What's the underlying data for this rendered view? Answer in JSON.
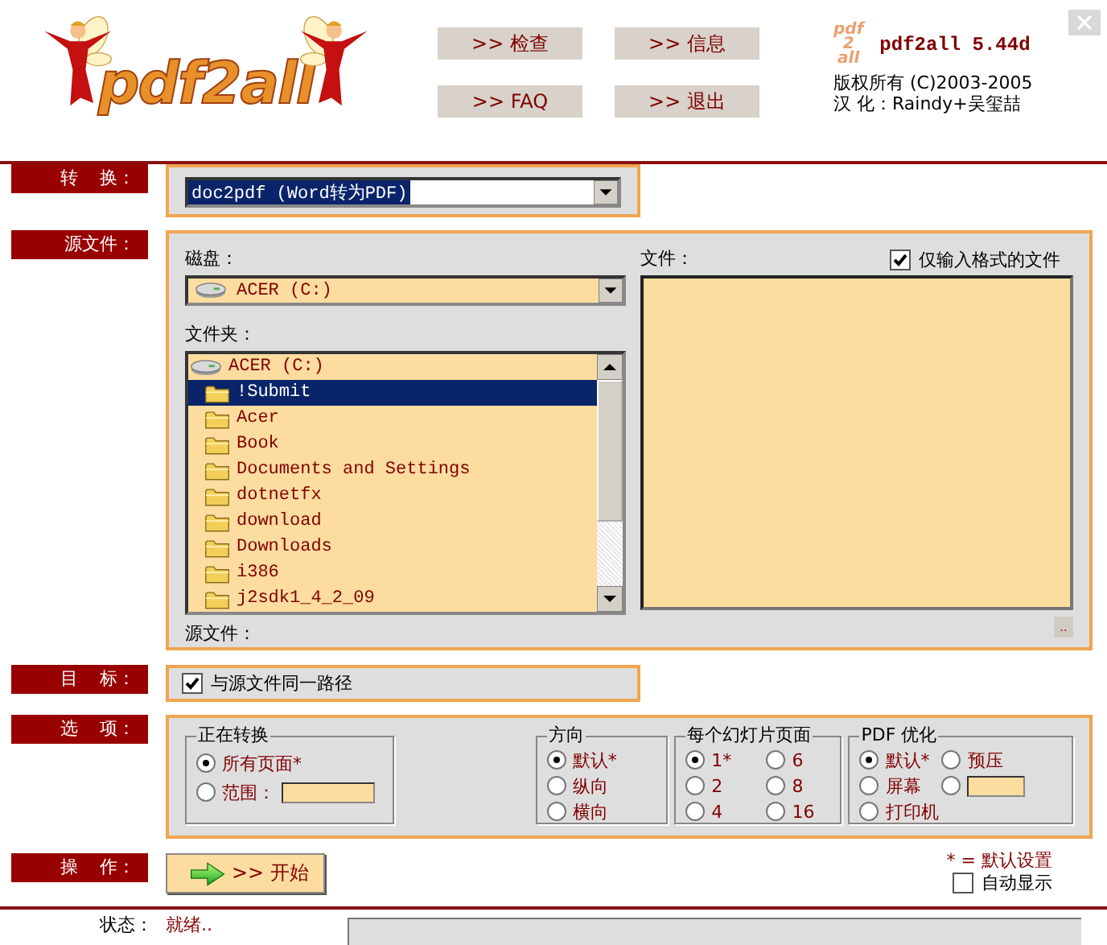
{
  "logo": {
    "text": "pdf2all"
  },
  "header_buttons": [
    ">> 检查",
    ">> 信息",
    ">> FAQ",
    ">> 退出"
  ],
  "app_info": {
    "logo_lines": [
      "pdf",
      "2",
      "all"
    ],
    "version": "pdf2all 5.44d",
    "copyright": "版权所有 (C)2003-2005",
    "localized_by": "汉 化：Raindy+吴玺喆"
  },
  "convert": {
    "label": "转 换：",
    "value": "doc2pdf (Word转为PDF)"
  },
  "source": {
    "label": "源文件：",
    "disk_label": "磁盘：",
    "disk_value": "ACER (C:)",
    "folder_label": "文件夹：",
    "folders": [
      {
        "name": "ACER (C:)",
        "kind": "drive",
        "selected": false
      },
      {
        "name": "!Submit",
        "kind": "folder",
        "selected": true
      },
      {
        "name": "Acer",
        "kind": "folder",
        "selected": false
      },
      {
        "name": "Book",
        "kind": "folder",
        "selected": false
      },
      {
        "name": "Documents and Settings",
        "kind": "folder",
        "selected": false
      },
      {
        "name": "dotnetfx",
        "kind": "folder",
        "selected": false
      },
      {
        "name": "download",
        "kind": "folder",
        "selected": false
      },
      {
        "name": "Downloads",
        "kind": "folder",
        "selected": false
      },
      {
        "name": "i386",
        "kind": "folder",
        "selected": false
      },
      {
        "name": "j2sdk1_4_2_09",
        "kind": "folder",
        "selected": false
      }
    ],
    "files_label": "文件：",
    "filter": {
      "label": "仅输入格式的文件",
      "checked": true
    },
    "source_file_label": "源文件：",
    "browse_button": ".."
  },
  "target": {
    "label": "目 标：",
    "same_path": {
      "label": "与源文件同一路径",
      "checked": true
    }
  },
  "options": {
    "label": "选 项：",
    "groups": [
      {
        "title": "正在转换",
        "columns": [
          [
            {
              "label": "所有页面*",
              "kind": "radio",
              "selected": true
            },
            {
              "label": "范围：",
              "kind": "radio_input",
              "selected": false
            }
          ]
        ]
      },
      {
        "title": "方向",
        "columns": [
          [
            {
              "label": "默认*",
              "kind": "radio",
              "selected": true
            },
            {
              "label": "纵向",
              "kind": "radio",
              "selected": false
            },
            {
              "label": "横向",
              "kind": "radio",
              "selected": false
            }
          ]
        ]
      },
      {
        "title": "每个幻灯片页面",
        "columns": [
          [
            {
              "label": "1*",
              "kind": "radio",
              "selected": true
            },
            {
              "label": "2",
              "kind": "radio",
              "selected": false
            },
            {
              "label": "4",
              "kind": "radio",
              "selected": false
            }
          ],
          [
            {
              "label": "6",
              "kind": "radio",
              "selected": false
            },
            {
              "label": "8",
              "kind": "radio",
              "selected": false
            },
            {
              "label": "16",
              "kind": "radio",
              "selected": false
            }
          ]
        ]
      },
      {
        "title": "PDF 优化",
        "columns": [
          [
            {
              "label": "默认*",
              "kind": "radio",
              "selected": true
            },
            {
              "label": "屏幕",
              "kind": "radio",
              "selected": false
            },
            {
              "label": "打印机",
              "kind": "radio",
              "selected": false
            }
          ],
          [
            {
              "label": "预压",
              "kind": "radio",
              "selected": false
            },
            {
              "kind": "input",
              "selected": false
            }
          ]
        ]
      }
    ]
  },
  "action": {
    "label": "操 作：",
    "start_button": ">> 开始",
    "default_note": "* = 默认设置",
    "auto_show": {
      "label": "自动显示",
      "checked": false
    }
  },
  "status": {
    "label": "状态：",
    "text": "就绪..",
    "level": 0
  }
}
